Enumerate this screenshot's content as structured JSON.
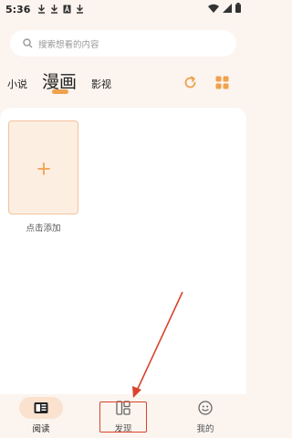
{
  "status_bar": {
    "time": "5:36",
    "left_icons": [
      "download-icon",
      "download-icon",
      "a-box-icon",
      "download-icon"
    ],
    "right_icons": [
      "wifi-icon",
      "signal-icon",
      "battery-icon"
    ]
  },
  "search": {
    "placeholder": "搜索想看的内容",
    "icon": "search-icon"
  },
  "tabs": [
    {
      "label": "小说",
      "active": false
    },
    {
      "label": "漫画",
      "active": true
    },
    {
      "label": "影视",
      "active": false
    }
  ],
  "toolbar_icons": [
    "refresh-icon",
    "grid-icon"
  ],
  "content": {
    "add_card_icon": "plus-icon",
    "add_label": "点击添加"
  },
  "bottom_nav": [
    {
      "label": "阅读",
      "icon": "book-icon",
      "active": true
    },
    {
      "label": "发现",
      "icon": "discover-icon",
      "active": false
    },
    {
      "label": "我的",
      "icon": "profile-icon",
      "active": false
    }
  ],
  "colors": {
    "accent": "#f0a14c",
    "background": "#fbf4ef",
    "annotation": "#d9442b"
  }
}
